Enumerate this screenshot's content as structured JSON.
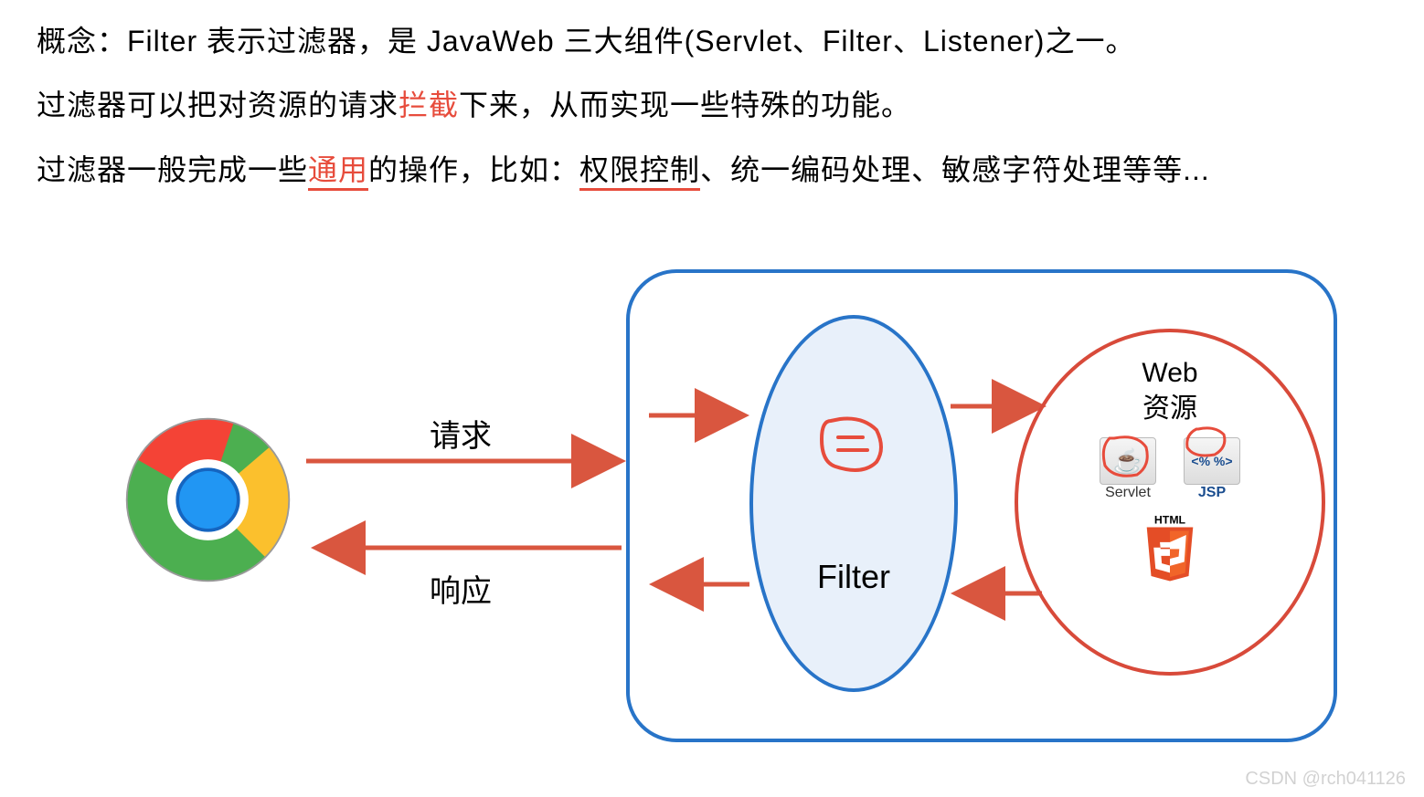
{
  "text": {
    "p1a": "概念：Filter 表示过滤器，是 JavaWeb 三大组件(Servlet、Filter、Listener)之一。",
    "p2_before": "过滤器可以把对资源的请求",
    "p2_hl": "拦截",
    "p2_after": "下来，从而实现一些特殊的功能。",
    "p3_before": "过滤器一般完成一些",
    "p3_hl1": "通用",
    "p3_mid": "的操作，比如：",
    "p3_hl2": "权限控制",
    "p3_after": "、统一编码处理、敏感字符处理等等..."
  },
  "labels": {
    "request": "请求",
    "response": "响应",
    "filter": "Filter",
    "web_res1": "Web",
    "web_res2": "资源",
    "servlet": "Servlet",
    "jsp": "JSP",
    "html5": "HTML"
  },
  "watermark": "CSDN @rch041126"
}
